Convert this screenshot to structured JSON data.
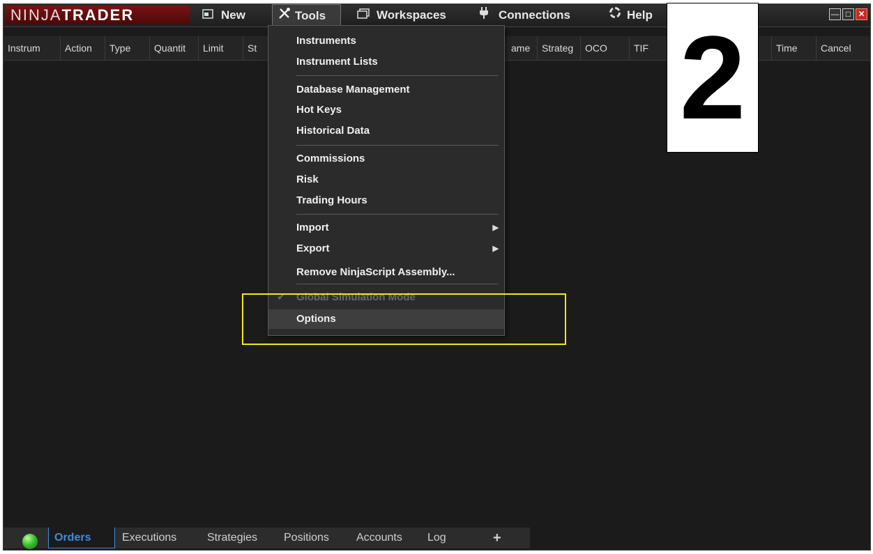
{
  "app": {
    "logo_light": "NINJA",
    "logo_bold": "TRADER",
    "colors": {
      "window_bg": "#1b1b1b",
      "logo_red": "#7a1212",
      "active_tab": "#3d8de0",
      "highlight_box": "#f2ea1a"
    }
  },
  "menubar": {
    "items": [
      {
        "label": "New",
        "icon": "new-window-icon"
      },
      {
        "label": "Tools",
        "icon": "tools-icon",
        "active": true
      },
      {
        "label": "Workspaces",
        "icon": "workspaces-icon"
      },
      {
        "label": "Connections",
        "icon": "plug-icon"
      },
      {
        "label": "Help",
        "icon": "help-ring-icon"
      }
    ],
    "window_controls": [
      "minimize-icon",
      "maximize-icon",
      "close-icon"
    ]
  },
  "columns": [
    "Instrum",
    "Action",
    "Type",
    "Quantit",
    "Limit",
    "St",
    "ame",
    "Strateg",
    "OCO",
    "TIF",
    "Time",
    "Cancel"
  ],
  "tools_menu": {
    "items": [
      {
        "label": "Instruments"
      },
      {
        "label": "Instrument Lists"
      },
      {
        "label": "Database Management"
      },
      {
        "label": "Hot Keys"
      },
      {
        "label": "Historical Data"
      },
      {
        "label": "Commissions"
      },
      {
        "label": "Risk"
      },
      {
        "label": "Trading Hours"
      },
      {
        "label": "Import",
        "submenu": true
      },
      {
        "label": "Export",
        "submenu": true
      },
      {
        "label": "Remove NinjaScript Assembly..."
      },
      {
        "label": "Global Simulation Mode",
        "checked": true,
        "disabled": true
      },
      {
        "label": "Options",
        "highlighted": true
      }
    ]
  },
  "tabs": {
    "status_icon": "connection-status-led-icon",
    "items": [
      "Orders",
      "Executions",
      "Strategies",
      "Positions",
      "Accounts",
      "Log"
    ],
    "active": "Orders",
    "add_label": "+"
  },
  "annotation": {
    "step_number": "2"
  }
}
